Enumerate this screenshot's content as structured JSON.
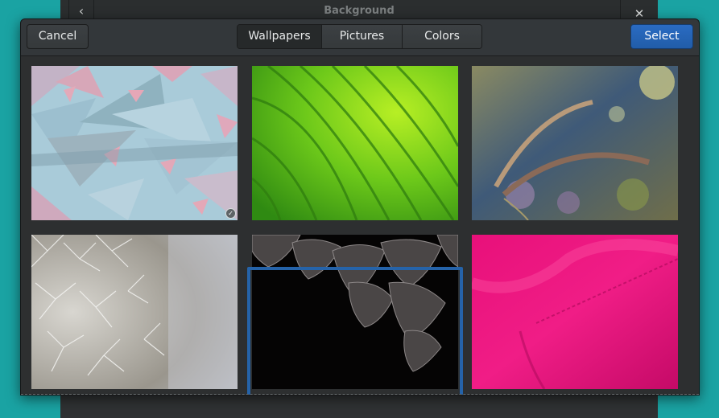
{
  "parent": {
    "title": "Background",
    "back_glyph": "‹",
    "close_glyph": "✕"
  },
  "header": {
    "cancel_label": "Cancel",
    "select_label": "Select",
    "tabs": [
      {
        "label": "Wallpapers",
        "active": true
      },
      {
        "label": "Pictures",
        "active": false
      },
      {
        "label": "Colors",
        "active": false
      }
    ]
  },
  "wallpapers": [
    {
      "name": "pastel-polygons",
      "selected": false,
      "current": true
    },
    {
      "name": "green-leaf",
      "selected": false,
      "current": false
    },
    {
      "name": "grass-seedheads",
      "selected": false,
      "current": false
    },
    {
      "name": "dandelion",
      "selected": false,
      "current": false
    },
    {
      "name": "dark-leaves",
      "selected": true,
      "current": false
    },
    {
      "name": "pink-fabric",
      "selected": false,
      "current": false
    }
  ],
  "colors": {
    "accent": "#215da9",
    "desktop": "#1aa3a3"
  }
}
